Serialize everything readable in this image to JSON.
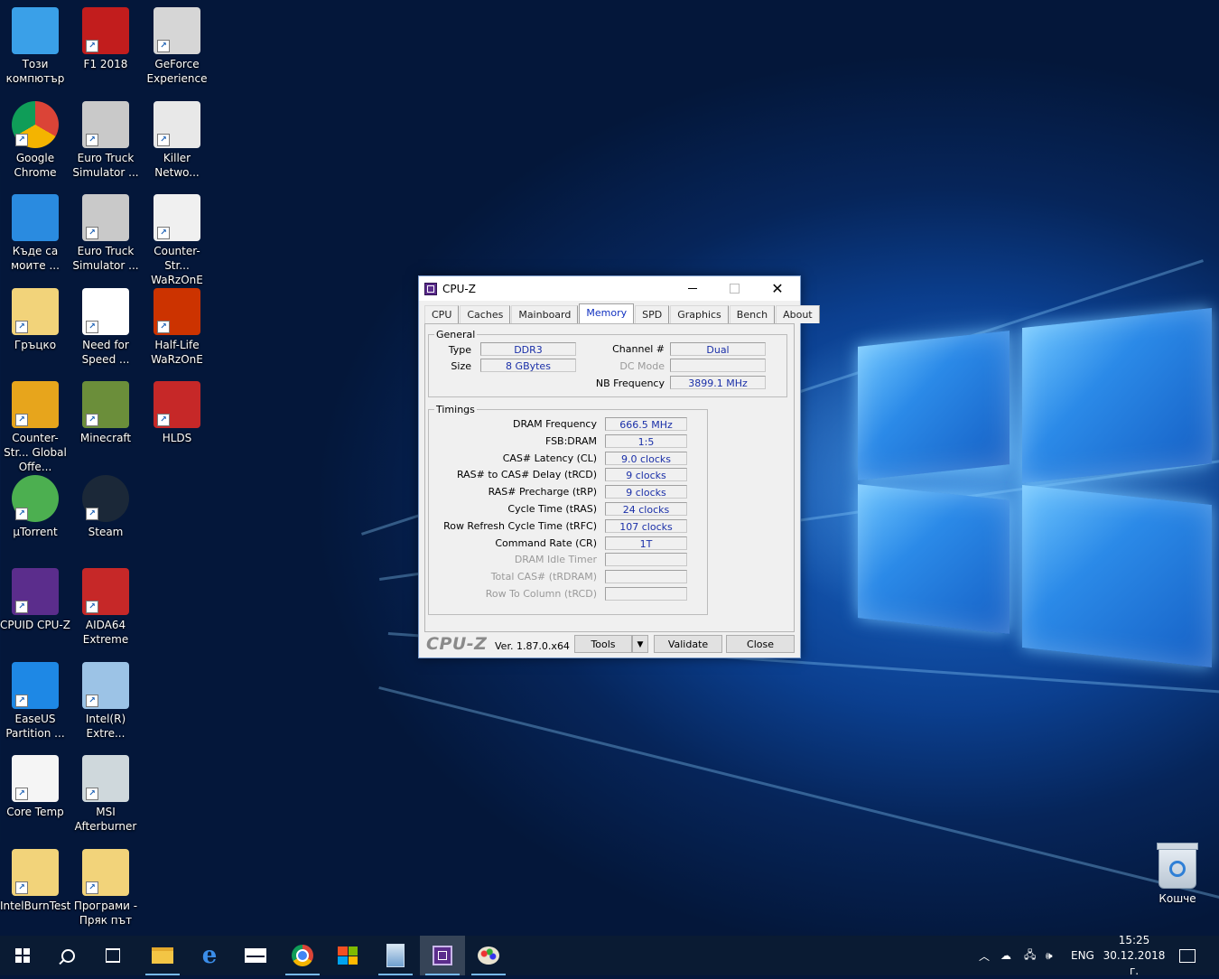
{
  "desktop": {
    "icons": [
      {
        "label": "Този компютър",
        "icon": "computer-icon"
      },
      {
        "label": "F1 2018",
        "icon": "game-icon"
      },
      {
        "label": "GeForce Experience",
        "icon": "geforce-icon"
      },
      {
        "label": "Google Chrome",
        "icon": "chrome-icon"
      },
      {
        "label": "Euro Truck Simulator ...",
        "icon": "truck-icon"
      },
      {
        "label": "Killer Netwo...",
        "icon": "killer-icon"
      },
      {
        "label": "Къде са моите ...",
        "icon": "onedrive-icon"
      },
      {
        "label": "Euro Truck Simulator ...",
        "icon": "truck-icon"
      },
      {
        "label": "Counter-Str... WaRzOnE",
        "icon": "cs-icon"
      },
      {
        "label": "Гръцко",
        "icon": "folder-icon"
      },
      {
        "label": "Need for Speed ...",
        "icon": "nfs-icon"
      },
      {
        "label": "Half-Life WaRzOnE",
        "icon": "halflife-icon"
      },
      {
        "label": "Counter-Str... Global Offe...",
        "icon": "csgo-icon"
      },
      {
        "label": "Minecraft",
        "icon": "minecraft-icon"
      },
      {
        "label": "HLDS",
        "icon": "hlds-icon"
      },
      {
        "label": "µTorrent",
        "icon": "utorrent-icon"
      },
      {
        "label": "Steam",
        "icon": "steam-icon"
      },
      {
        "label": "CPUID CPU-Z",
        "icon": "cpuz-icon"
      },
      {
        "label": "AIDA64 Extreme",
        "icon": "aida64-icon"
      },
      {
        "label": "EaseUS Partition ...",
        "icon": "easeus-icon"
      },
      {
        "label": "Intel(R) Extre...",
        "icon": "intel-icon"
      },
      {
        "label": "Core Temp",
        "icon": "coretemp-icon"
      },
      {
        "label": "MSI Afterburner",
        "icon": "msi-icon"
      },
      {
        "label": "IntelBurnTest",
        "icon": "folder-icon"
      },
      {
        "label": "Програми - Пряк път",
        "icon": "folder-icon"
      }
    ],
    "recycle_bin": "Кошче"
  },
  "cpuz": {
    "title": "CPU-Z",
    "tabs": [
      "CPU",
      "Caches",
      "Mainboard",
      "Memory",
      "SPD",
      "Graphics",
      "Bench",
      "About"
    ],
    "active_tab": "Memory",
    "general": {
      "legend": "General",
      "type_label": "Type",
      "type_value": "DDR3",
      "size_label": "Size",
      "size_value": "8 GBytes",
      "channel_label": "Channel #",
      "channel_value": "Dual",
      "dcmode_label": "DC Mode",
      "dcmode_value": "",
      "nbfreq_label": "NB Frequency",
      "nbfreq_value": "3899.1 MHz"
    },
    "timings": {
      "legend": "Timings",
      "rows": [
        {
          "label": "DRAM Frequency",
          "value": "666.5 MHz",
          "dim": false
        },
        {
          "label": "FSB:DRAM",
          "value": "1:5",
          "dim": false
        },
        {
          "label": "CAS# Latency (CL)",
          "value": "9.0 clocks",
          "dim": false
        },
        {
          "label": "RAS# to CAS# Delay (tRCD)",
          "value": "9 clocks",
          "dim": false
        },
        {
          "label": "RAS# Precharge (tRP)",
          "value": "9 clocks",
          "dim": false
        },
        {
          "label": "Cycle Time (tRAS)",
          "value": "24 clocks",
          "dim": false
        },
        {
          "label": "Row Refresh Cycle Time (tRFC)",
          "value": "107 clocks",
          "dim": false
        },
        {
          "label": "Command Rate (CR)",
          "value": "1T",
          "dim": false
        },
        {
          "label": "DRAM Idle Timer",
          "value": "",
          "dim": true
        },
        {
          "label": "Total CAS# (tRDRAM)",
          "value": "",
          "dim": true
        },
        {
          "label": "Row To Column (tRCD)",
          "value": "",
          "dim": true
        }
      ]
    },
    "footer": {
      "logo": "CPU-Z",
      "version": "Ver. 1.87.0.x64",
      "tools": "Tools",
      "validate": "Validate",
      "close": "Close"
    }
  },
  "taskbar": {
    "language": "ENG",
    "time": "15:25",
    "date": "30.12.2018 г."
  }
}
